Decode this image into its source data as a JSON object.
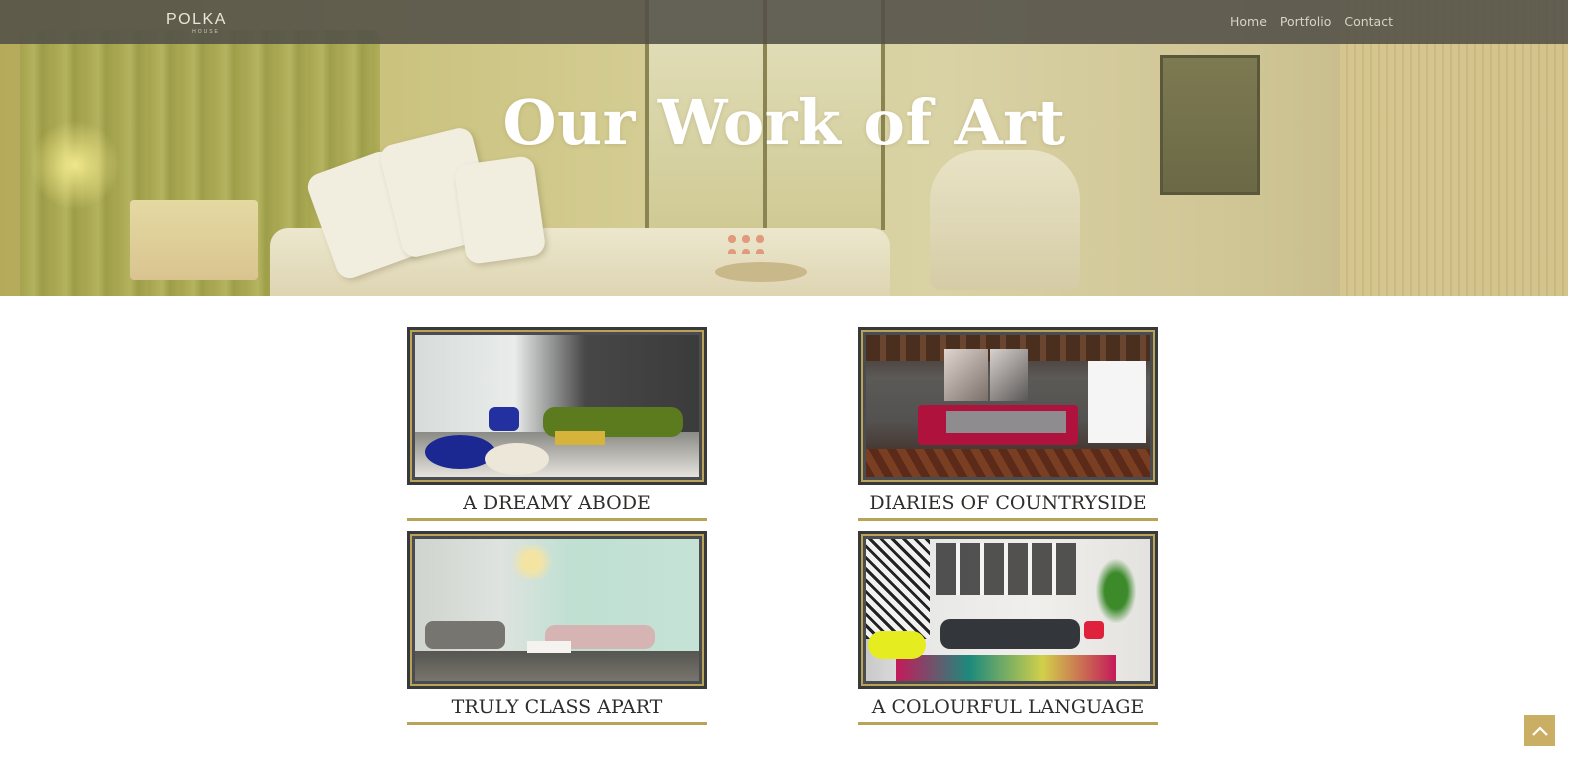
{
  "brand": {
    "logo_main": "POLKA",
    "logo_sub": "HOUSE"
  },
  "nav": {
    "links": [
      "Home",
      "Portfolio",
      "Contact"
    ]
  },
  "hero": {
    "title": "Our Work of Art"
  },
  "portfolio": {
    "items": [
      {
        "caption": "A DREAMY ABODE"
      },
      {
        "caption": "DIARIES OF COUNTRYSIDE"
      },
      {
        "caption": "TRULY CLASS APART"
      },
      {
        "caption": "A COLOURFUL LANGUAGE"
      }
    ]
  },
  "icons": {
    "scroll_top": "chevron-up-icon"
  },
  "colors": {
    "accent_gold": "#b9a359",
    "nav_bg": "#525048",
    "frame_dark": "#38393b",
    "scroll_button": "#c9ae64"
  }
}
